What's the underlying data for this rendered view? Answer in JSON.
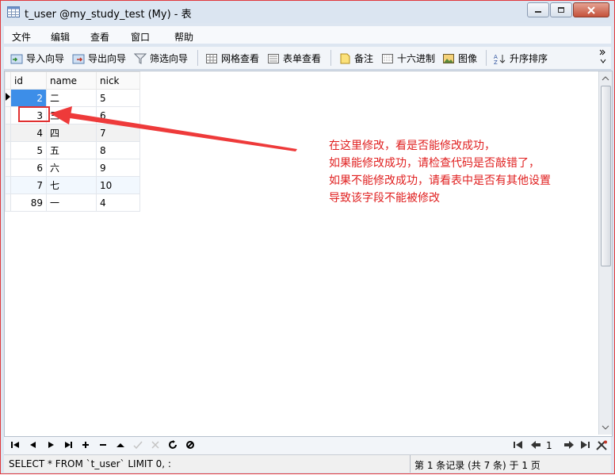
{
  "window": {
    "title": "t_user @my_study_test (My) - 表",
    "min_icon": "minimize-icon",
    "max_icon": "maximize-icon",
    "close_icon": "close-icon"
  },
  "menu": [
    "文件",
    "编辑",
    "查看",
    "窗口",
    "帮助"
  ],
  "toolbar": [
    {
      "label": "导入向导",
      "icon": "import-wizard-icon"
    },
    {
      "label": "导出向导",
      "icon": "export-wizard-icon"
    },
    {
      "label": "筛选向导",
      "icon": "filter-wizard-icon"
    },
    {
      "label": "网格查看",
      "icon": "grid-view-icon"
    },
    {
      "label": "表单查看",
      "icon": "form-view-icon"
    },
    {
      "label": "备注",
      "icon": "memo-icon"
    },
    {
      "label": "十六进制",
      "icon": "hex-icon"
    },
    {
      "label": "图像",
      "icon": "image-icon"
    },
    {
      "label": "升序排序",
      "icon": "sort-asc-icon"
    }
  ],
  "table": {
    "columns": [
      "id",
      "name",
      "nick"
    ],
    "rows": [
      {
        "id": "2",
        "name": "二",
        "nick": "5"
      },
      {
        "id": "3",
        "name": "三",
        "nick": "6"
      },
      {
        "id": "4",
        "name": "四",
        "nick": "7"
      },
      {
        "id": "5",
        "name": "五",
        "nick": "8"
      },
      {
        "id": "6",
        "name": "六",
        "nick": "9"
      },
      {
        "id": "7",
        "name": "七",
        "nick": "10"
      },
      {
        "id": "89",
        "name": "一",
        "nick": "4"
      }
    ]
  },
  "annotation": {
    "lines": [
      "在这里修改，看是否能修改成功，",
      "如果能修改成功，请检查代码是否敲错了，",
      "如果不能修改成功，请看表中是否有其他设置",
      "导致该字段不能被修改"
    ],
    "color": "#e02020"
  },
  "pager": {
    "page": "1"
  },
  "status": {
    "sql": "SELECT * FROM `t_user` LIMIT 0, :",
    "info": "第 1 条记录 (共 7 条) 于 1 页"
  }
}
